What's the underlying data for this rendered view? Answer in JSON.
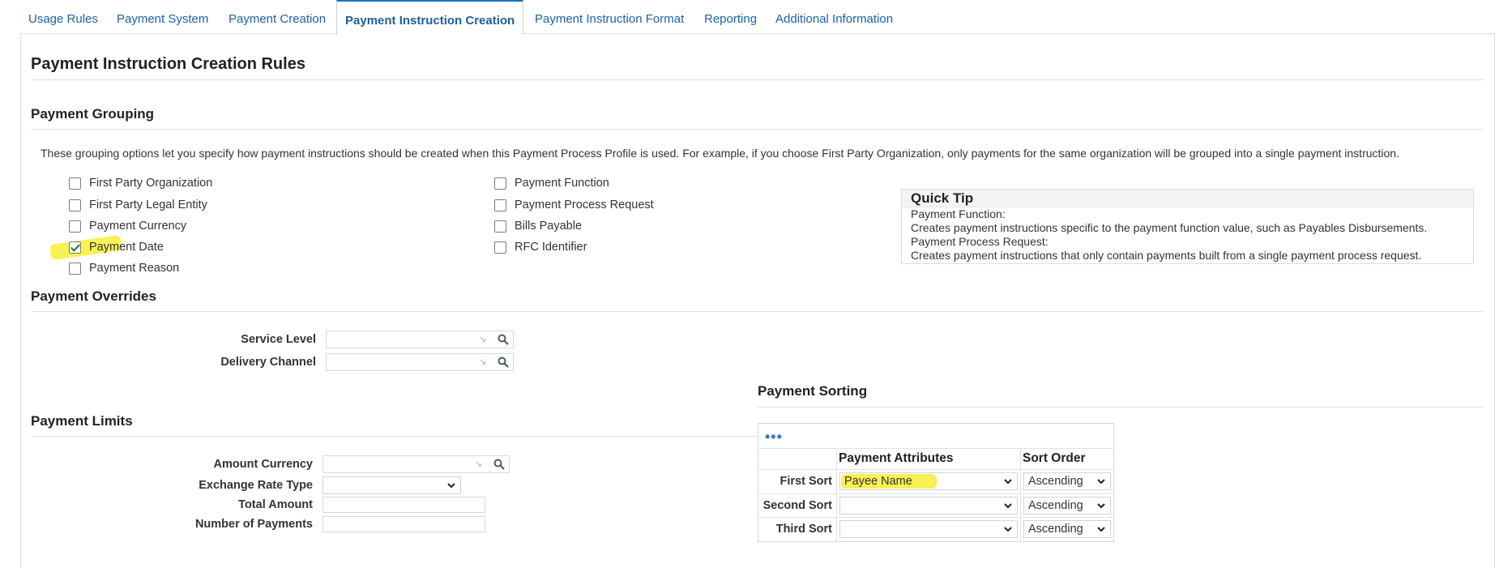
{
  "tabs": [
    {
      "label": "Usage Rules"
    },
    {
      "label": "Payment System"
    },
    {
      "label": "Payment Creation"
    },
    {
      "label": "Payment Instruction Creation",
      "active": true
    },
    {
      "label": "Payment Instruction Format"
    },
    {
      "label": "Reporting"
    },
    {
      "label": "Additional Information"
    }
  ],
  "page_title": "Payment Instruction Creation Rules",
  "grouping": {
    "title": "Payment Grouping",
    "description": "These grouping options let you specify how payment instructions should be created when this Payment Process Profile is used. For example, if you choose First Party Organization, only payments for the same organization will be grouped into a single payment instruction.",
    "left_options": [
      {
        "label": "First Party Organization",
        "checked": false
      },
      {
        "label": "First Party Legal Entity",
        "checked": false
      },
      {
        "label": "Payment Currency",
        "checked": false
      },
      {
        "label": "Payment Date",
        "checked": true
      },
      {
        "label": "Payment Reason",
        "checked": false
      }
    ],
    "right_options": [
      {
        "label": "Payment Function",
        "checked": false
      },
      {
        "label": "Payment Process Request",
        "checked": false
      },
      {
        "label": "Bills Payable",
        "checked": false
      },
      {
        "label": "RFC Identifier",
        "checked": false
      }
    ]
  },
  "quick_tip": {
    "title": "Quick Tip",
    "lines": [
      "Payment Function:",
      "Creates payment instructions specific to the payment function value, such as Payables Disbursements.",
      "Payment Process Request:",
      "Creates payment instructions that only contain payments built from a single payment process request."
    ]
  },
  "overrides": {
    "title": "Payment Overrides",
    "service_level_label": "Service Level",
    "service_level_value": "",
    "delivery_channel_label": "Delivery Channel",
    "delivery_channel_value": ""
  },
  "limits": {
    "title": "Payment Limits",
    "amount_currency_label": "Amount Currency",
    "amount_currency_value": "",
    "exchange_rate_type_label": "Exchange Rate Type",
    "exchange_rate_type_value": "",
    "total_amount_label": "Total Amount",
    "total_amount_value": "",
    "number_of_payments_label": "Number of Payments",
    "number_of_payments_value": ""
  },
  "sorting": {
    "title": "Payment Sorting",
    "toolbar_icon": "more-options-icon",
    "col_attributes": "Payment Attributes",
    "col_sort_order": "Sort Order",
    "rows": [
      {
        "label": "First Sort",
        "attribute": "Payee Name",
        "order": "Ascending"
      },
      {
        "label": "Second Sort",
        "attribute": "",
        "order": "Ascending"
      },
      {
        "label": "Third Sort",
        "attribute": "",
        "order": "Ascending"
      }
    ]
  },
  "colors": {
    "link": "#1a61a9",
    "active_tab_border": "#1f72c3",
    "highlight": "#f7f04a",
    "check": "#1f7a1f"
  }
}
